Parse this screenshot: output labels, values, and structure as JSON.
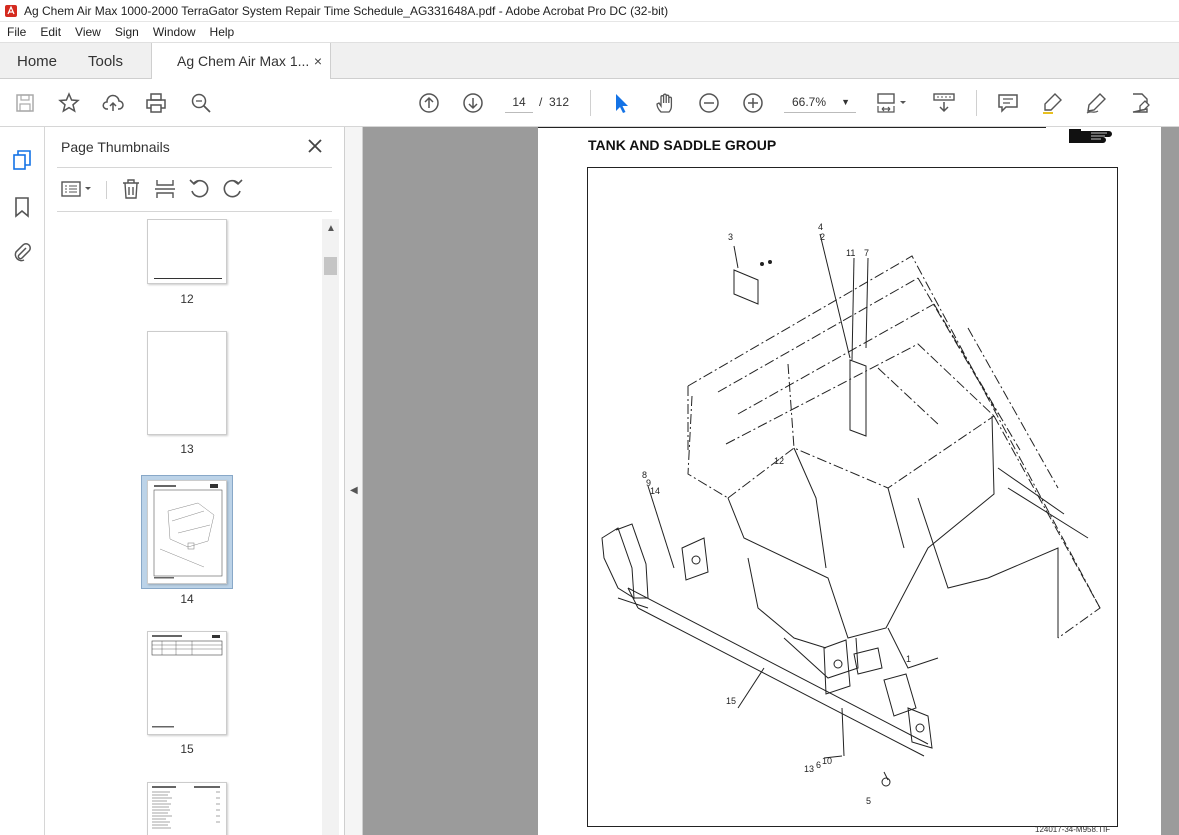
{
  "window": {
    "title": "Ag Chem Air Max 1000-2000 TerraGator System Repair Time Schedule_AG331648A.pdf - Adobe Acrobat Pro DC (32-bit)"
  },
  "menu": [
    "File",
    "Edit",
    "View",
    "Sign",
    "Window",
    "Help"
  ],
  "tabs": {
    "home": "Home",
    "tools": "Tools",
    "document": "Ag Chem Air Max 1...",
    "close": "×"
  },
  "toolbar": {
    "page_current": "14",
    "page_separator": "/",
    "page_total": "312",
    "zoom": "66.7%"
  },
  "panel": {
    "title": "Page Thumbnails",
    "thumbnails": [
      {
        "label": "12"
      },
      {
        "label": "13"
      },
      {
        "label": "14"
      },
      {
        "label": "15"
      }
    ]
  },
  "document": {
    "page_title": "TANK AND SADDLE GROUP",
    "caption": "124017-34-M958.TIF",
    "callouts": [
      "3",
      "4",
      "2",
      "11",
      "7",
      "12",
      "8",
      "9",
      "14",
      "15",
      "1",
      "13",
      "6",
      "10",
      "5"
    ]
  },
  "icons": {
    "save": "save-icon",
    "bookmark": "star-icon",
    "upload": "cloud-upload-icon",
    "print": "printer-icon",
    "search": "zoom-search-icon",
    "prev": "arrow-up-circle-icon",
    "next": "arrow-down-circle-icon",
    "select": "cursor-icon",
    "hand": "hand-icon",
    "zoom_out": "minus-circle-icon",
    "zoom_in": "plus-circle-icon",
    "fit": "fit-page-icon",
    "scroll": "scroll-mode-icon",
    "comment": "comment-icon",
    "highlight": "highlighter-icon",
    "sign": "pen-icon",
    "share": "share-edit-icon"
  },
  "colors": {
    "accent": "#1473e6",
    "doc_background": "#9b9b9b",
    "selection": "#bcd3e8"
  }
}
